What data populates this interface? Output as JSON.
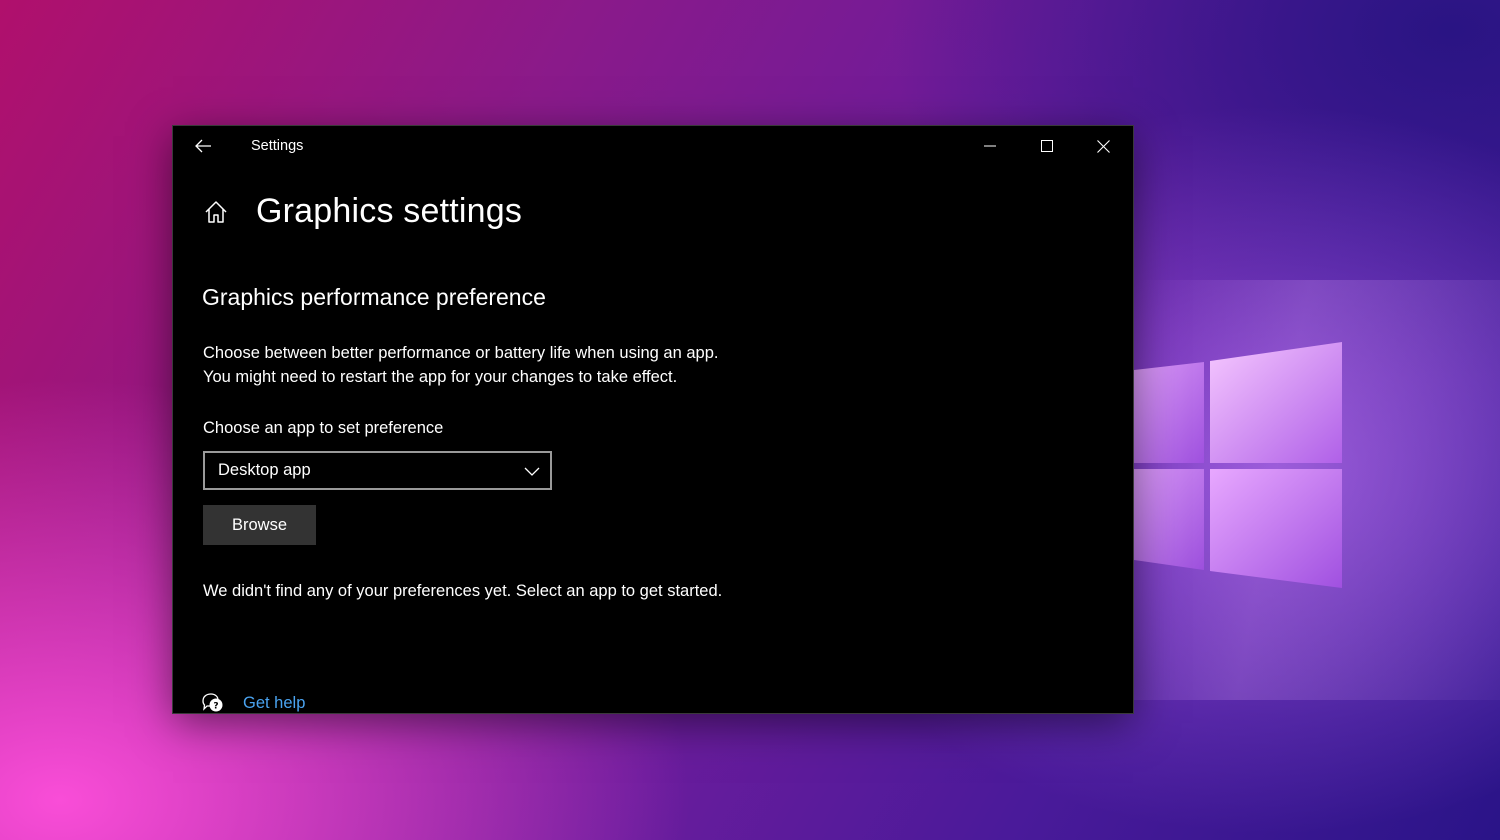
{
  "window": {
    "title": "Settings"
  },
  "page": {
    "title": "Graphics settings",
    "section_title": "Graphics performance preference",
    "description_line1": "Choose between better performance or battery life when using an app.",
    "description_line2": "You might need to restart the app for your changes to take effect.",
    "choose_label": "Choose an app to set preference",
    "dropdown_value": "Desktop app",
    "browse_label": "Browse",
    "empty_message": "We didn't find any of your preferences yet. Select an app to get started.",
    "help_link": "Get help"
  },
  "icons": {
    "back": "back-arrow-icon",
    "minimize": "minimize-icon",
    "maximize": "maximize-icon",
    "close": "close-icon",
    "home": "home-icon",
    "dropdown": "chevron-down-icon",
    "help": "chat-help-icon"
  },
  "colors": {
    "window_bg": "#000000",
    "link": "#4aa3f0",
    "button_bg": "#333333",
    "dropdown_border": "#9a9a9a"
  }
}
